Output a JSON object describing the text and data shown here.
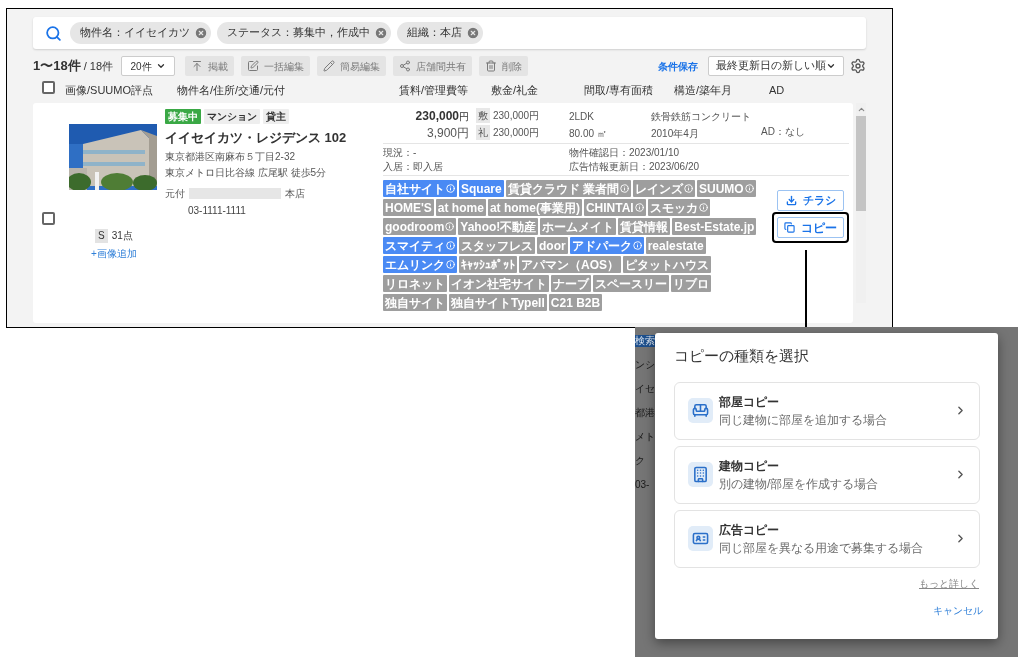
{
  "search_chips": [
    "物件名：イイセイカツ",
    "ステータス：募集中，作成中",
    "組織：本店"
  ],
  "toolbar": {
    "count": "1〜18件",
    "total": "/ 18件",
    "page_size": "20件",
    "actions": [
      {
        "label": "掲載",
        "kind": "publish",
        "disabled": true
      },
      {
        "label": "一括編集",
        "kind": "bulk",
        "disabled": true
      },
      {
        "label": "簡易編集",
        "kind": "edit",
        "disabled": true
      },
      {
        "label": "店舗間共有",
        "kind": "share",
        "disabled": true
      },
      {
        "label": "削除",
        "kind": "delete",
        "disabled": true
      }
    ],
    "save_link": "条件保存",
    "sort": "最終更新日の新しい順"
  },
  "header": {
    "checked": false,
    "columns": [
      "画像/SUUMO評点",
      "物件名/住所/交通/元付",
      "賃料/管理費等",
      "敷金/礼金",
      "間取/専有面積",
      "構造/築年月",
      "AD"
    ]
  },
  "listing": {
    "checked": false,
    "score_grade": "S",
    "score": "31点",
    "add_image": "+画像追加",
    "badges": [
      {
        "label": "募集中",
        "kind": "status"
      },
      {
        "label": "マンション",
        "kind": "plain"
      },
      {
        "label": "貸主",
        "kind": "plain"
      }
    ],
    "name": "イイセイカツ・レジデンス 102",
    "address": "東京都港区南麻布５丁目2-32",
    "access": "東京メトロ日比谷線 広尾駅 徒歩5分",
    "agent_label": "元付",
    "agent_branch": "本店",
    "phone": "03-1111-1111",
    "rent": "230,000",
    "rent_unit": "円",
    "fee": "3,900円",
    "deposit_label": "敷",
    "deposit": "230,000円",
    "key_money_label": "礼",
    "key_money": "230,000円",
    "layout": "2LDK",
    "area": "80.00 ㎡",
    "structure": "鉄骨鉄筋コンクリート",
    "built": "2010年4月",
    "ad": "AD：なし",
    "status": "現況：-",
    "move_in": "入居：即入居",
    "confirmed": "物件確認日：2023/01/10",
    "ad_updated": "広告情報更新日：2023/06/20",
    "tags": [
      {
        "label": "自社サイト",
        "color": "#4a8af4",
        "info": true
      },
      {
        "label": "Square",
        "color": "#4a8af4",
        "info": false
      },
      {
        "label": "賃貸クラウド 業者間",
        "color": "#9e9e9e",
        "info": true
      },
      {
        "label": "レインズ",
        "color": "#9e9e9e",
        "info": true
      },
      {
        "label": "SUUMO",
        "color": "#9e9e9e",
        "info": true
      },
      {
        "label": "HOME'S",
        "color": "#9e9e9e",
        "info": false
      },
      {
        "label": "at home",
        "color": "#9e9e9e",
        "info": false
      },
      {
        "label": "at home(事業用)",
        "color": "#9e9e9e",
        "info": false
      },
      {
        "label": "CHINTAI",
        "color": "#9e9e9e",
        "info": true
      },
      {
        "label": "スモッカ",
        "color": "#9e9e9e",
        "info": true
      },
      {
        "label": "goodroom",
        "color": "#9e9e9e",
        "info": true
      },
      {
        "label": "Yahoo!不動産",
        "color": "#9e9e9e",
        "info": false
      },
      {
        "label": "ホームメイト",
        "color": "#9e9e9e",
        "info": false
      },
      {
        "label": "賃貸情報",
        "color": "#9e9e9e",
        "info": false
      },
      {
        "label": "Best-Estate.jp",
        "color": "#9e9e9e",
        "info": false
      },
      {
        "label": "スマイティ",
        "color": "#4a8af4",
        "info": true
      },
      {
        "label": "スタッフレス",
        "color": "#9e9e9e",
        "info": false
      },
      {
        "label": "door",
        "color": "#9e9e9e",
        "info": false
      },
      {
        "label": "アドパーク",
        "color": "#4a8af4",
        "info": true
      },
      {
        "label": "realestate",
        "color": "#9e9e9e",
        "info": false
      },
      {
        "label": "エムリンク",
        "color": "#4a8af4",
        "info": true
      },
      {
        "label": "ｷｬｯｼｭﾎﾟｯﾄ",
        "color": "#9e9e9e",
        "info": false
      },
      {
        "label": "アパマン（AOS）",
        "color": "#9e9e9e",
        "info": false
      },
      {
        "label": "ピタットハウス",
        "color": "#9e9e9e",
        "info": false
      },
      {
        "label": "リロネット",
        "color": "#9e9e9e",
        "info": false
      },
      {
        "label": "イオン社宅サイト",
        "color": "#9e9e9e",
        "info": false
      },
      {
        "label": "ナーブ",
        "color": "#9e9e9e",
        "info": false
      },
      {
        "label": "スペースリー",
        "color": "#9e9e9e",
        "info": false
      },
      {
        "label": "リブロ",
        "color": "#9e9e9e",
        "info": false
      },
      {
        "label": "独自サイト",
        "color": "#9e9e9e",
        "info": false
      },
      {
        "label": "独自サイトTypeII",
        "color": "#9e9e9e",
        "info": false
      },
      {
        "label": "C21 B2B",
        "color": "#9e9e9e",
        "info": false
      }
    ],
    "flyer_button": "チラシ",
    "copy_button": "コピー"
  },
  "background_fragments": [
    "検索",
    "ンシ",
    "イセ",
    "都港",
    "メト",
    "ク",
    "03-"
  ],
  "dialog": {
    "title": "コピーの種類を選択",
    "options": [
      {
        "kind": "room",
        "title": "部屋コピー",
        "description": "同じ建物に部屋を追加する場合"
      },
      {
        "kind": "building",
        "title": "建物コピー",
        "description": "別の建物/部屋を作成する場合"
      },
      {
        "kind": "ad",
        "title": "広告コピー",
        "description": "同じ部屋を異なる用途で募集する場合"
      }
    ],
    "more_link": "もっと詳しく",
    "cancel": "キャンセル"
  }
}
